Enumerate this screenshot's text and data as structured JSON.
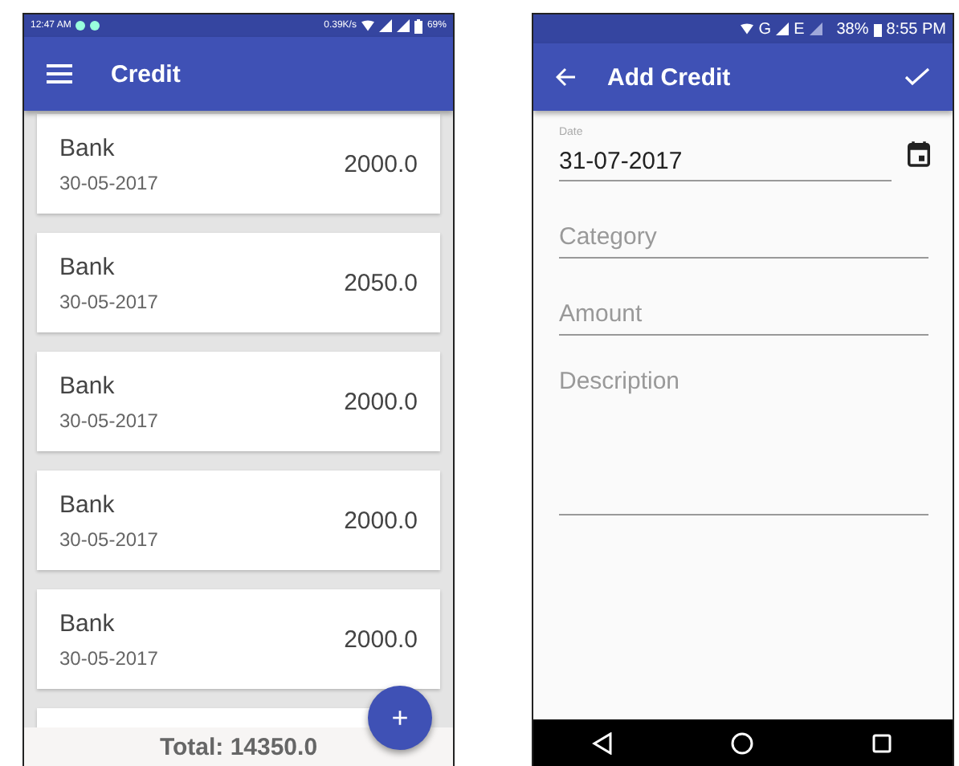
{
  "list_screen": {
    "status_bar": {
      "time": "12:47 AM",
      "speed": "0.39K/s",
      "battery": "69%"
    },
    "toolbar": {
      "title": "Credit"
    },
    "entries": [
      {
        "category": "Bank",
        "date": "30-05-2017",
        "amount": "2000.0"
      },
      {
        "category": "Bank",
        "date": "30-05-2017",
        "amount": "2050.0"
      },
      {
        "category": "Bank",
        "date": "30-05-2017",
        "amount": "2000.0"
      },
      {
        "category": "Bank",
        "date": "30-05-2017",
        "amount": "2000.0"
      },
      {
        "category": "Bank",
        "date": "30-05-2017",
        "amount": "2000.0"
      }
    ],
    "total": "Total: 14350.0",
    "fab": "+"
  },
  "form_screen": {
    "status_bar": {
      "network_g": "G",
      "network_e": "E",
      "battery": "38%",
      "time": "8:55 PM"
    },
    "toolbar": {
      "title": "Add Credit"
    },
    "date": {
      "label": "Date",
      "value": "31-07-2017"
    },
    "fields": [
      {
        "placeholder": "Category"
      },
      {
        "placeholder": "Amount"
      },
      {
        "placeholder": "Description"
      }
    ]
  }
}
